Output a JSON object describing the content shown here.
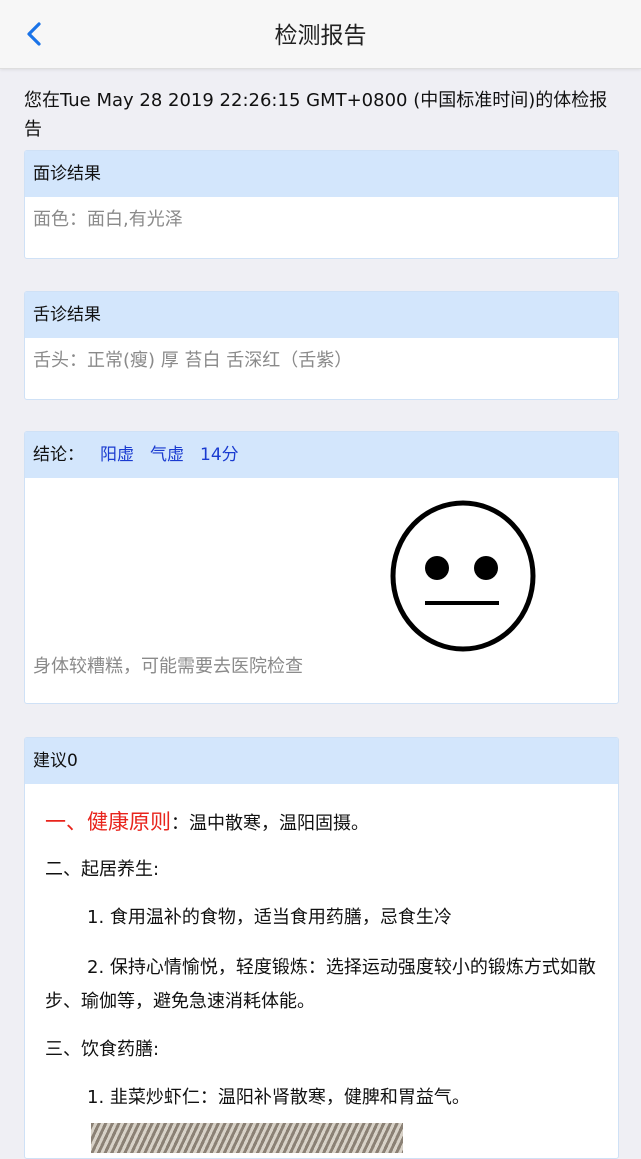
{
  "nav": {
    "title": "检测报告"
  },
  "intro": "您在Tue May 28 2019 22:26:15 GMT+0800 (中国标准时间)的体检报告",
  "face_card": {
    "header": "面诊结果",
    "body": "面色：面白,有光泽"
  },
  "tongue_card": {
    "header": "舌诊结果",
    "body": "舌头：正常(瘦) 厚 苔白 舌深红（舌紫）"
  },
  "conclusion_card": {
    "label": "结论：",
    "tags": [
      "阳虚",
      "气虚",
      "14分"
    ],
    "body": "身体较糟糕，可能需要去医院检查",
    "face_icon": "neutral-face-icon"
  },
  "advice_card": {
    "header": "建议0",
    "principle_title": "一、健康原则",
    "principle_text": "：温中散寒，温阳固摄。",
    "living_title": "二、起居养生:",
    "living_1": "1. 食用温补的食物，适当食用药膳，忌食生冷",
    "living_2": "2. 保持心情愉悦，轻度锻炼：选择运动强度较小的锻炼方式如散步、瑜伽等，避免急速消耗体能。",
    "diet_title": "三、饮食药膳:",
    "diet_1": "1. 韭菜炒虾仁：温阳补肾散寒，健脾和胃益气。"
  },
  "colors": {
    "accent": "#1a73e8",
    "header_bg": "#d3e6fc",
    "red": "#e8241c",
    "tag_blue": "#1a3bd0"
  }
}
